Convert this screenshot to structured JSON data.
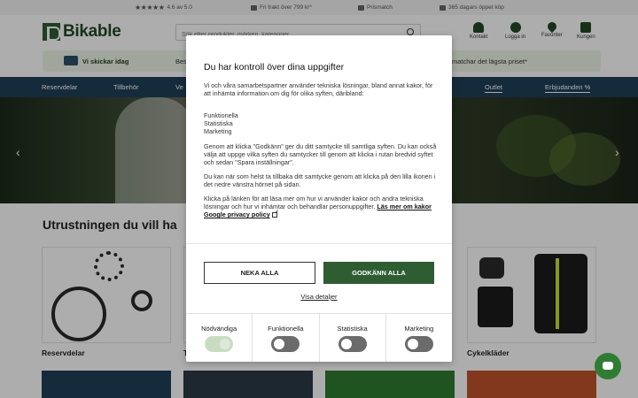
{
  "topbar": {
    "rating_stars": "★★★★★",
    "rating": "4.6 av 5.0",
    "shipping": "Fri frakt över 799 kr*",
    "price_match": "Prismatch",
    "returns": "365 dagars öppet köp"
  },
  "header": {
    "logo_text": "Bikable",
    "search_placeholder": "Sök efter produkter, märken, kategorier...",
    "icons": [
      {
        "label": "Kontakt",
        "icon": "contact-icon"
      },
      {
        "label": "Logga in",
        "icon": "user-icon"
      },
      {
        "label": "Favoriter",
        "icon": "heart-icon"
      },
      {
        "label": "Kungen",
        "icon": "cart-icon",
        "badge": "0"
      }
    ]
  },
  "shipping_bar": {
    "bold": "Vi skickar idag",
    "text": "Beställ",
    "right": "matchar det lägsta priset*"
  },
  "nav": {
    "items": [
      "Reservdelar",
      "Tillbehör",
      "Ve"
    ],
    "right_items": [
      "Outlet",
      "Erbjudanden %"
    ]
  },
  "hero": {
    "prev": "‹",
    "next": "›"
  },
  "section": {
    "title": "Utrustningen du vill ha",
    "cards": [
      "Reservdelar",
      "T",
      "Cykelkläder"
    ]
  },
  "modal": {
    "title": "Du har kontroll över dina uppgifter",
    "p1": "Vi och våra samarbetspartner använder tekniska lösningar, bland annat kakor, för att inhämta information om dig för olika syften, däribland:",
    "purposes": [
      "Funktionella",
      "Statistiska",
      "Marketing"
    ],
    "p2": "Genom att klicka \"Godkänn\" ger du ditt samtycke till samtliga syften. Du kan också välja att uppge vilka syften du samtycker till genom att klicka i rutan bredvid syftet och sedan \"Spara inställningar\".",
    "p3": "Du kan när som helst ta tillbaka ditt samtycke genom att klicka på den lilla ikonen i det nedre vänstra hörnet på sidan.",
    "p4": "Klicka på länken för att läsa mer om hur vi använder kakor och andra tekniska lösningar och hur vi inhämtar och behandlar personuppgifter.",
    "link_more": "Läs mer om kakor",
    "link_google": "Google privacy policy",
    "deny_label": "NEKA ALLA",
    "accept_label": "GODKÄNN ALLA",
    "details_label": "Visa detaljer",
    "toggles": [
      {
        "label": "Nödvändiga",
        "on": true
      },
      {
        "label": "Funktionella",
        "on": false
      },
      {
        "label": "Statistiska",
        "on": false
      },
      {
        "label": "Marketing",
        "on": false
      }
    ]
  },
  "colors": {
    "brand_green": "#2e5d32",
    "nav_blue": "#1e4058",
    "chat_green": "#2e7d32"
  }
}
